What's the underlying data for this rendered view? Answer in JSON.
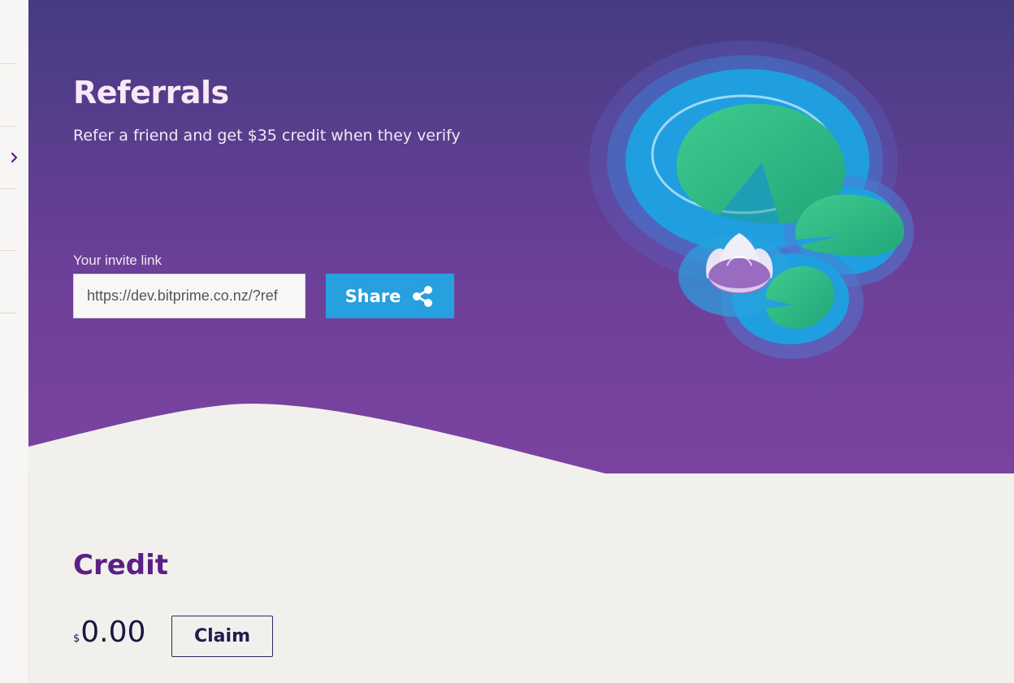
{
  "hero": {
    "title": "Referrals",
    "subtitle": "Refer a friend and get $35 credit when they verify",
    "invite_label": "Your invite link",
    "invite_link": "https://dev.bitprime.co.nz/?ref",
    "share_label": "Share"
  },
  "credit": {
    "heading": "Credit",
    "currency": "$",
    "amount": "0.00",
    "claim_label": "Claim"
  },
  "icons": {
    "sidebar_expand": "chevron-right-icon",
    "share": "share-icon",
    "illustration": "lily-pad-lotus-illustration"
  },
  "colors": {
    "hero_top": "#453c82",
    "hero_bottom": "#7b43a0",
    "accent_blue": "#26a0df",
    "heading_purple": "#5b1f86",
    "page_bg": "#f2f0ed"
  }
}
